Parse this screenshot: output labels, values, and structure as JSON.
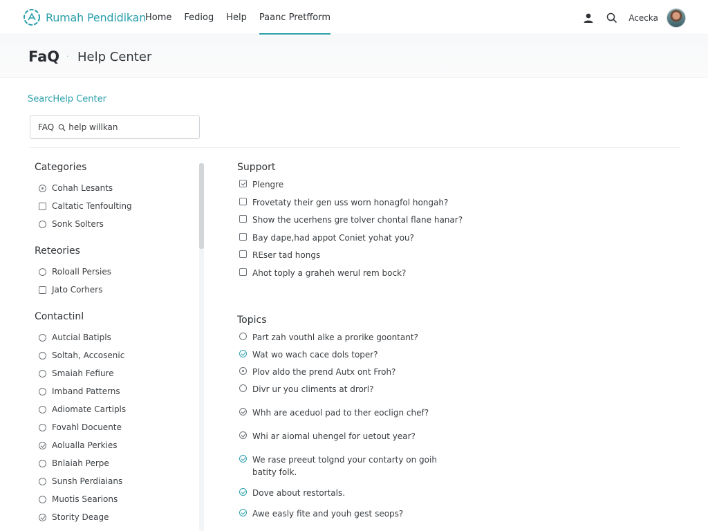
{
  "brand": {
    "name": "Rumah Pendidikan",
    "accent": "#2b9fab"
  },
  "nav": {
    "items": [
      "Home",
      "Fediog",
      "Help",
      "Paanc Pretfform"
    ],
    "active_index": 3
  },
  "topbar": {
    "username": "Acecka"
  },
  "page": {
    "title": "FaQ",
    "separator": "·",
    "subtitle": "Help Center"
  },
  "search": {
    "label": "SearcHelp Center",
    "prefix": "FAQ",
    "value": "help willkan"
  },
  "sidebar": {
    "sections": [
      {
        "heading": "Categories",
        "items": [
          "Cohah Lesants",
          "Caltatic Tenfoulting",
          "Sonk Solters"
        ]
      },
      {
        "heading": "Reteories",
        "items": [
          "Roloall Persies",
          "Jato Corhers"
        ]
      },
      {
        "heading": "Contactinl",
        "items": [
          "Autcial Batipls",
          "Soltah, Accosenic",
          "Smaiah Fefiure",
          "Imband Patterns",
          "Adiomate Cartipls",
          "Fovahl Docuente",
          "Aolualla Perkies",
          "Bnlaiah Perpe",
          "Sunsh Perdiaians",
          "Muotis Searions",
          "Stority Deage"
        ]
      }
    ]
  },
  "support": {
    "heading": "Support",
    "items": [
      "Plengre",
      "Frovetaty their gen uss worn honagfol hongah?",
      "Show the ucerhens gre tolver chontal flane hanar?",
      "Bay dape,had appot Coniet yohat you?",
      "REser tad hongs",
      "Ahot toply a graheh werul rem bock?"
    ]
  },
  "topics": {
    "heading": "Topics",
    "items": [
      "Part zah vouthl alke a prorike goontant?",
      "Wat wo wach cace dols toper?",
      "Plov aldo the prend Autx ont Froh?",
      "Divr ur you climents at drorl?",
      "Whh are aceduol pad to ther eoclign chef?",
      "Whi ar aiomal uhengel for uetout year?",
      "We rase preeut tolgnd your contarty on goih batity folk.",
      "Dove about restortals.",
      "Awe easly fite and youh gest seops?"
    ]
  }
}
